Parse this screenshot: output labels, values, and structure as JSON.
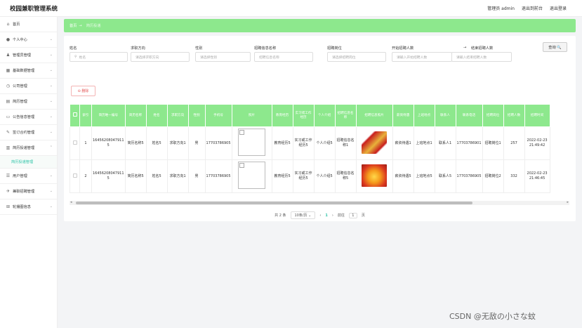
{
  "app": {
    "title": "校园兼职管理系统"
  },
  "header": {
    "user": "管理员 admin",
    "back": "退出到前台",
    "logout": "退出登录"
  },
  "sidebar": {
    "items": [
      {
        "label": "首页",
        "icon": "home-icon",
        "glyph": "⌂",
        "chev": ""
      },
      {
        "label": "个人中心",
        "icon": "user-icon",
        "glyph": "●",
        "chev": "⌄"
      },
      {
        "label": "管理员管理",
        "icon": "person-icon",
        "glyph": "♟",
        "chev": "⌄"
      },
      {
        "label": "基础数据管理",
        "icon": "grid-icon",
        "glyph": "▦",
        "chev": "⌄"
      },
      {
        "label": "公司管理",
        "icon": "clock-icon",
        "glyph": "◷",
        "chev": "⌄"
      },
      {
        "label": "简历管理",
        "icon": "shirt-icon",
        "glyph": "▤",
        "chev": "⌄"
      },
      {
        "label": "公告信息管理",
        "icon": "doc-icon",
        "glyph": "▭",
        "chev": "⌄"
      },
      {
        "label": "签订合约管理",
        "icon": "contract-icon",
        "glyph": "✎",
        "chev": "⌄"
      },
      {
        "label": "简历投递管理",
        "icon": "send-icon",
        "glyph": "▥",
        "chev": "⌃"
      },
      {
        "label": "用户管理",
        "icon": "users-icon",
        "glyph": "☰",
        "chev": "⌄"
      },
      {
        "label": "兼职招聘管理",
        "icon": "briefcase-icon",
        "glyph": "✈",
        "chev": "⌄"
      },
      {
        "label": "轮播图信息",
        "icon": "image-icon",
        "glyph": "⊞",
        "chev": "⌄"
      }
    ],
    "sub_active": "简历投递管理"
  },
  "breadcrumb": {
    "home": "首页",
    "sep": "→",
    "current": "简历投递"
  },
  "filters": {
    "name_label": "姓名",
    "name_ph": "姓名",
    "direction_label": "求职方向",
    "direction_ph": "请选择求职方向",
    "gender_label": "性别",
    "gender_ph": "请选择性别",
    "job_info_label": "招聘信息名称",
    "job_info_ph": "招聘信息名称",
    "position_label": "招聘岗位",
    "position_ph": "请选择招聘岗位",
    "start_label": "开始招聘人数",
    "start_ph": "请输入开始招聘人数",
    "arrow": "→",
    "end_label": "结束招聘人数",
    "end_ph": "请输入结束招聘人数",
    "query": "查询 🔍"
  },
  "delete_label": "⊖ 删除",
  "table": {
    "columns": [
      "",
      "索引",
      "简历唯一编号",
      "简历名称",
      "姓名",
      "求职方向",
      "性别",
      "手机号",
      "照片",
      "教育经历",
      "实习或工作经历",
      "个人介绍",
      "招聘信息名称",
      "招聘信息照片",
      "薪资待遇",
      "上班地点",
      "联系人",
      "联系电话",
      "招聘岗位",
      "招聘人数",
      "招聘时间"
    ],
    "rows": [
      {
        "idx": "1",
        "no": "16456208047911 5",
        "resume": "简历名称5",
        "name": "姓名5",
        "dir": "求职方向1",
        "gender": "男",
        "phone": "17703786905",
        "edu": "教育经历5",
        "exp": "实习或工作经历5",
        "intro": "个人介绍5",
        "job": "招聘信息名称1",
        "salary": "薪资待遇1",
        "place": "上班地点1",
        "contact": "联系人1",
        "tel": "17703786901",
        "post": "招聘岗位1",
        "count": "257",
        "time": "2022-02-23 21:49:42"
      },
      {
        "idx": "2",
        "no": "16456208047911 5",
        "resume": "简历名称5",
        "name": "姓名5",
        "dir": "求职方向1",
        "gender": "男",
        "phone": "17703786905",
        "edu": "教育经历5",
        "exp": "实习或工作经历5",
        "intro": "个人介绍5",
        "job": "招聘信息名称5",
        "salary": "薪资待遇5",
        "place": "上班地点5",
        "contact": "联系人5",
        "tel": "17703786905",
        "post": "招聘岗位2",
        "count": "332",
        "time": "2022-02-23 21:46:45"
      }
    ]
  },
  "pager": {
    "total": "共 2 条",
    "size": "10条/页",
    "prev": "‹",
    "page": "1",
    "next": "›",
    "goto": "前往",
    "goto_val": "1",
    "unit": "页"
  },
  "watermark": "CSDN @无敌の小さな蚊",
  "colors": {
    "accent": "#8de88d",
    "active": "#2fc4a8",
    "danger": "#e45656"
  }
}
